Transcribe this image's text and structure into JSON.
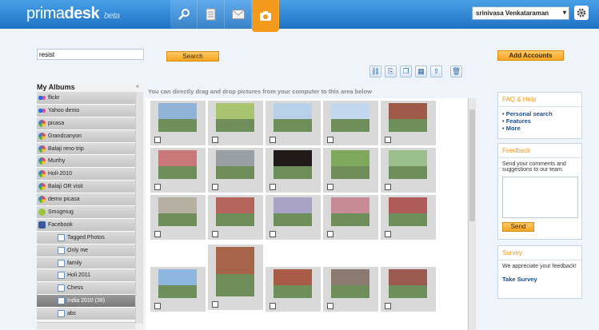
{
  "app": {
    "logo_main": "prima",
    "logo_accent": "desk",
    "logo_tag": "beta"
  },
  "nav": {
    "icons": [
      "search-icon",
      "document-icon",
      "mail-icon",
      "photos-icon"
    ],
    "active": "photos-icon"
  },
  "user": {
    "name": "srinivasa Venkataraman"
  },
  "search": {
    "value": "resist",
    "button": "Search"
  },
  "accounts": {
    "button": "Add Accounts"
  },
  "toolbar": {
    "icons": [
      "link-icon",
      "attach-icon",
      "copy-icon",
      "album-icon",
      "share-icon",
      "trash-icon"
    ]
  },
  "albums": {
    "title": "My Albums",
    "collapse": "«",
    "items": [
      {
        "label": "flickr",
        "icon": "flickr-icon",
        "sub": false,
        "color": "#e24a9a"
      },
      {
        "label": "Yahoo demo",
        "icon": "flickr-icon",
        "sub": false,
        "color": "#e24a9a"
      },
      {
        "label": "picasa",
        "icon": "picasa-icon",
        "sub": false,
        "color": "#f0502f"
      },
      {
        "label": "Grandcanyon",
        "icon": "picasa-icon",
        "sub": false,
        "color": "#f0502f"
      },
      {
        "label": "Balaji reno trip",
        "icon": "picasa-icon",
        "sub": false,
        "color": "#f0502f"
      },
      {
        "label": "Murthy",
        "icon": "picasa-icon",
        "sub": false,
        "color": "#f0502f"
      },
      {
        "label": "Holi-2010",
        "icon": "picasa-icon",
        "sub": false,
        "color": "#f0502f"
      },
      {
        "label": "Balaji OR visit",
        "icon": "picasa-icon",
        "sub": false,
        "color": "#f0502f"
      },
      {
        "label": "demo picasa",
        "icon": "picasa-icon",
        "sub": false,
        "color": "#f0502f"
      },
      {
        "label": "Smugmug",
        "icon": "smugmug-icon",
        "sub": false,
        "color": "#9bc33c"
      },
      {
        "label": "Facebook",
        "icon": "facebook-icon",
        "sub": false,
        "color": "#3b5998"
      },
      {
        "label": "Tagged Photos",
        "icon": "folder-grid-icon",
        "sub": true,
        "color": "#ffffff"
      },
      {
        "label": "Only me",
        "icon": "folder-grid-icon",
        "sub": true,
        "color": "#ffffff"
      },
      {
        "label": "family",
        "icon": "folder-grid-icon",
        "sub": true,
        "color": "#ffffff"
      },
      {
        "label": "Holi 2011",
        "icon": "folder-grid-icon",
        "sub": true,
        "color": "#ffffff"
      },
      {
        "label": "Chess",
        "icon": "folder-grid-icon",
        "sub": true,
        "color": "#ffffff"
      },
      {
        "label": "India 2010 (39)",
        "icon": "folder-grid-icon",
        "sub": true,
        "color": "#ffffff",
        "selected": true
      },
      {
        "label": "abc",
        "icon": "folder-grid-icon",
        "sub": true,
        "color": "#ffffff"
      }
    ]
  },
  "dropzone": {
    "message": "You can directly drag and drop pictures from your computer to this area below"
  },
  "photos": {
    "colors": [
      "#8fb4d8",
      "#a8c46e",
      "#b8d0e8",
      "#c2d8ee",
      "#a05a4a",
      "#c9787a",
      "#9a9fa6",
      "#201a18",
      "#7fa85c",
      "#9bbf8c",
      "#b6b0a2",
      "#b4645a",
      "#a8a2c4",
      "#c88a94",
      "#b05a5a",
      "#a8644a",
      "#8eb6de",
      "#a85c48",
      "#8a7a70",
      "#9a5a50"
    ]
  },
  "faq": {
    "title": "FAQ & Help",
    "links": [
      "• Personal search",
      "• Features",
      "• More"
    ]
  },
  "feedback": {
    "title": "Feedback",
    "text": "Send your comments and suggestions to our team.",
    "button": "Send"
  },
  "survey": {
    "title": "Survey",
    "text": "We appreciate your feedback!",
    "link": "Take Survey"
  }
}
